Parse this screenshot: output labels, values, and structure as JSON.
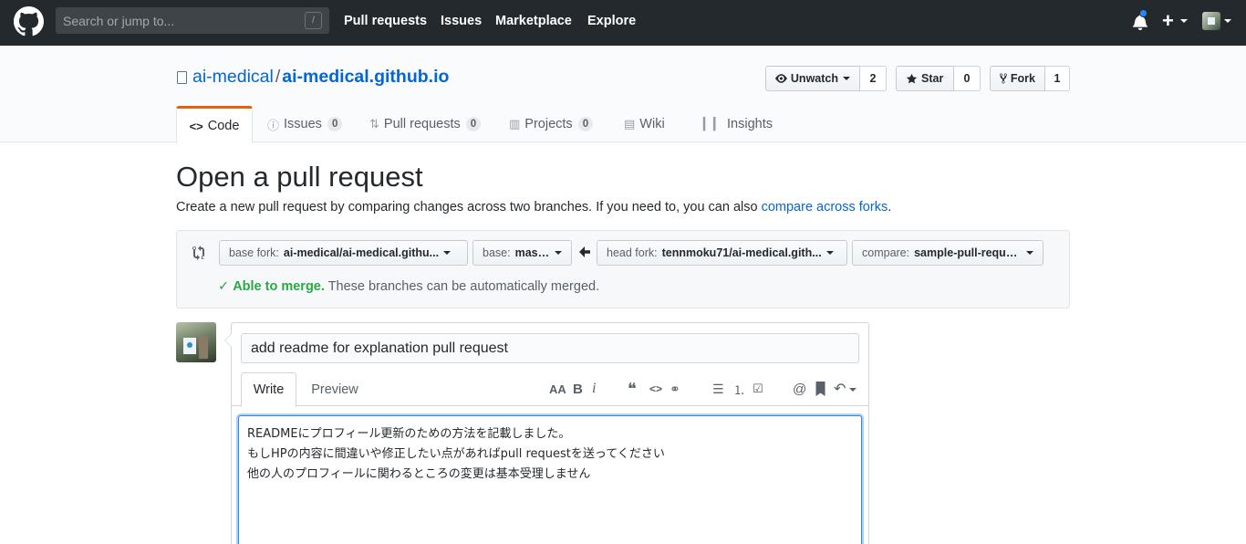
{
  "header": {
    "search_placeholder": "Search or jump to...",
    "slash_key": "/",
    "nav": [
      "Pull requests",
      "Issues",
      "Marketplace",
      "Explore"
    ],
    "plus_label": "+"
  },
  "repo": {
    "owner": "ai-medical",
    "separator": "/",
    "name": "ai-medical.github.io",
    "unwatch_label": "Unwatch",
    "watch_count": "2",
    "star_label": "Star",
    "star_count": "0",
    "fork_label": "Fork",
    "fork_count": "1"
  },
  "tabs": [
    {
      "label": "Code"
    },
    {
      "label": "Issues",
      "count": "0"
    },
    {
      "label": "Pull requests",
      "count": "0"
    },
    {
      "label": "Projects",
      "count": "0"
    },
    {
      "label": "Wiki"
    },
    {
      "label": "Insights"
    }
  ],
  "page": {
    "title": "Open a pull request",
    "lead_text": "Create a new pull request by comparing changes across two branches. If you need to, you can also ",
    "lead_link": "compare across forks",
    "lead_end": "."
  },
  "range": {
    "base_fork_label": "base fork:",
    "base_fork_value": "ai-medical/ai-medical.githu...",
    "base_label": "base:",
    "base_value": "master",
    "head_fork_label": "head fork:",
    "head_fork_value": "tennmoku71/ai-medical.gith...",
    "compare_label": "compare:",
    "compare_value": "sample-pull-request",
    "merge_ok": "Able to merge.",
    "merge_msg": "These branches can be automatically merged."
  },
  "composer": {
    "title_value": "add readme for explanation pull request",
    "write_tab": "Write",
    "preview_tab": "Preview",
    "toolbar": {
      "header": "AA",
      "bold": "B",
      "italic": "i",
      "quote": "❝",
      "code": "<>",
      "mention": "@"
    },
    "body_lines": [
      "READMEにプロフィール更新のための方法を記載しました。",
      "もしHPの内容に間違いや修正したい点があればpull requestを送ってください",
      "他の人のプロフィールに関わるところの変更は基本受理しません"
    ]
  },
  "colors": {
    "header_bg": "#24292e",
    "link": "#0366d6",
    "success": "#28a745",
    "tab_accent": "#e36209",
    "notification": "#2188ff"
  }
}
